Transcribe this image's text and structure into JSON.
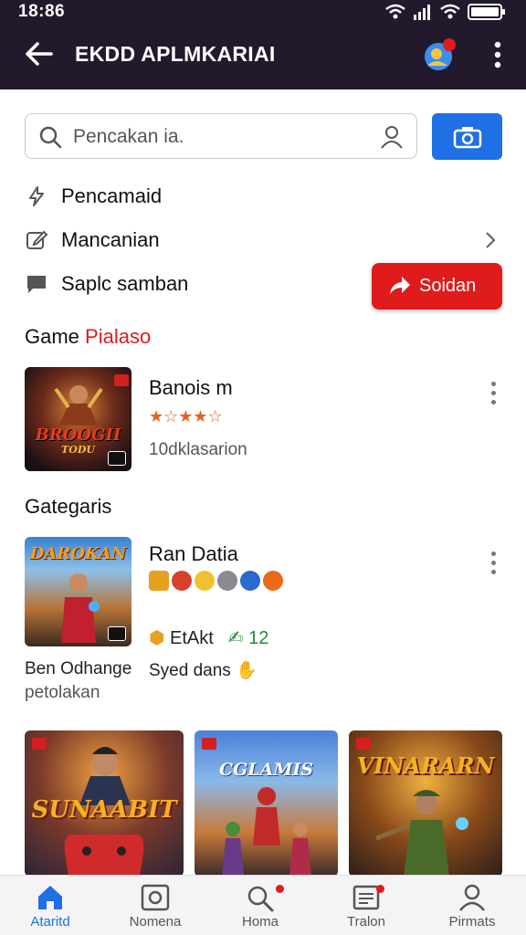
{
  "status_bar": {
    "time": "18:86"
  },
  "app_bar": {
    "title": "EKDD APLMKARIAI"
  },
  "search": {
    "placeholder": "Pencakan ia."
  },
  "menu": [
    {
      "icon": "lightning-icon",
      "label": "Pencamaid"
    },
    {
      "icon": "edit-icon",
      "label": "Mancanian"
    },
    {
      "icon": "chat-icon",
      "label": "Saplc samban"
    }
  ],
  "cta_button": {
    "label": "Soidan"
  },
  "section_game": {
    "title": "Game",
    "accent": "Pialaso"
  },
  "game_item": {
    "thumb_title": "BROOGII",
    "thumb_sub": "TODU",
    "title": "Banois m",
    "stars": "★☆★★☆",
    "subtitle": "10dklasarion"
  },
  "section_categories": {
    "title": "Gategaris"
  },
  "category_item": {
    "thumb_title": "DAROKAN",
    "title": "Ran Datia",
    "rating_a": "EtAkt",
    "rating_b": "12",
    "caption_left_1": "Ben Odhange",
    "caption_left_2": "petolakan",
    "caption_right": "Syed dans"
  },
  "tiles": [
    {
      "title": "SUNAABIT"
    },
    {
      "title": "CGLAMIS"
    },
    {
      "title": "VINARARN"
    }
  ],
  "bottom_nav": [
    {
      "label": "Ataritd",
      "icon": "home-icon",
      "active": true
    },
    {
      "label": "Nomena",
      "icon": "camera-icon",
      "active": false
    },
    {
      "label": "Homa",
      "icon": "search-icon",
      "active": false
    },
    {
      "label": "Tralon",
      "icon": "list-icon",
      "active": false
    },
    {
      "label": "Pirmats",
      "icon": "profile-icon",
      "active": false
    }
  ],
  "colors": {
    "topbar": "#221a2c",
    "accent_blue": "#1f6fe5",
    "accent_red": "#e01b1b"
  }
}
